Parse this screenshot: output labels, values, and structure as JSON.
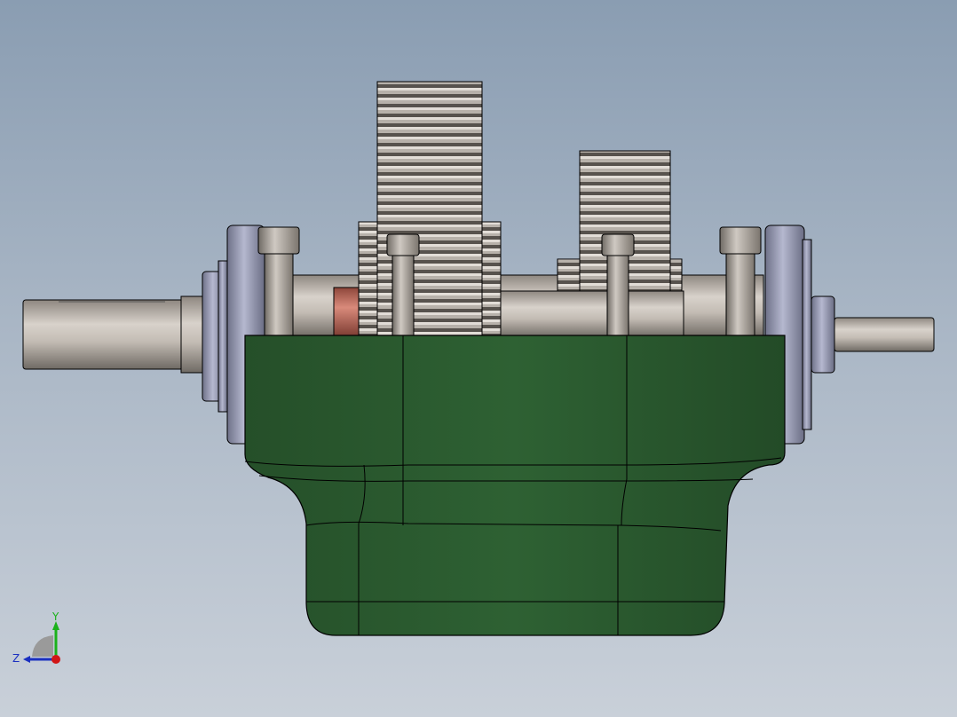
{
  "viewport": {
    "background_top": "#8a9db2",
    "background_bottom": "#c9d0d9"
  },
  "model": {
    "housing_color": "#2d5e31",
    "shaft_color": "#c3bcb4",
    "gear_color": "#b9b3ac",
    "flange_color": "#a9acc4",
    "bushing_color": "#c97162",
    "edge_color": "#000000"
  },
  "triad": {
    "y_label": "Y",
    "z_label": "Z",
    "y_color": "#1bb11b",
    "z_color": "#1a2fc0",
    "origin_color": "#d11616"
  }
}
